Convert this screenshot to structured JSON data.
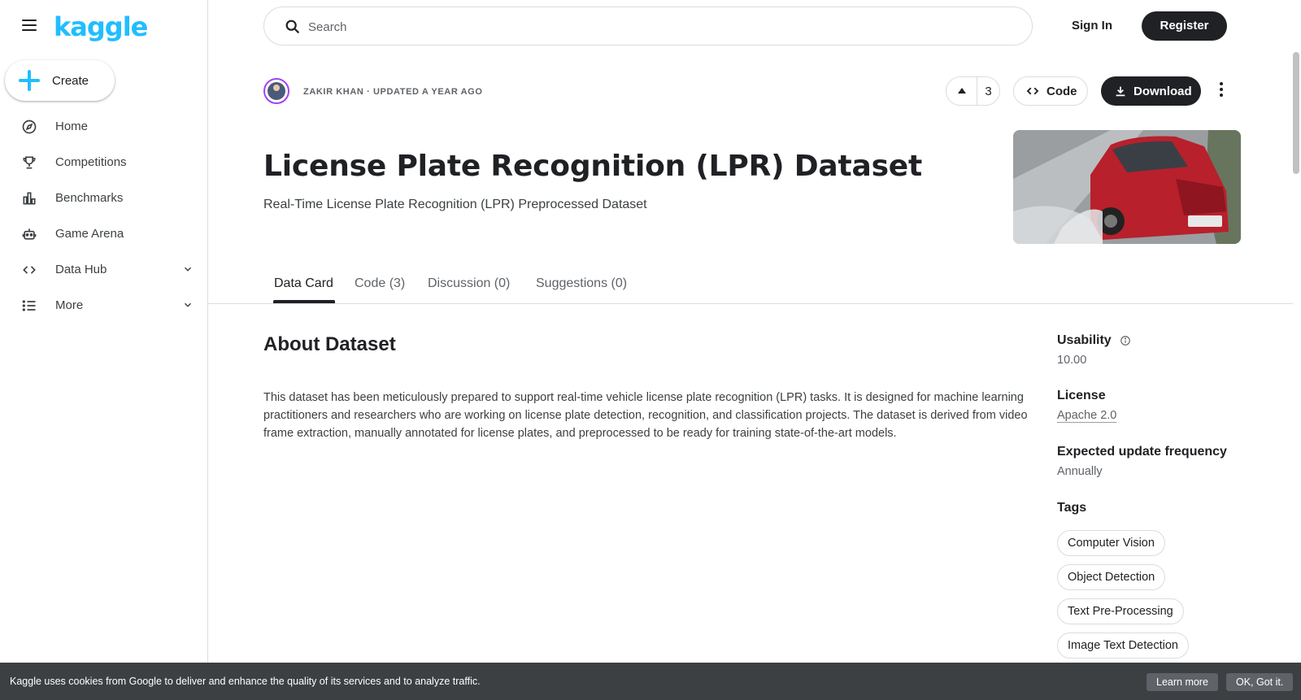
{
  "sidebar": {
    "logo": "kaggle",
    "create_label": "Create",
    "items": [
      {
        "label": "Home"
      },
      {
        "label": "Competitions"
      },
      {
        "label": "Benchmarks"
      },
      {
        "label": "Game Arena"
      },
      {
        "label": "Data Hub"
      },
      {
        "label": "More"
      }
    ]
  },
  "header": {
    "search_placeholder": "Search",
    "sign_in": "Sign In",
    "register": "Register"
  },
  "dataset": {
    "author_line": "ZAKIR KHAN · UPDATED A YEAR AGO",
    "vote_count": "3",
    "code_label": "Code",
    "download_label": "Download",
    "title": "License Plate Recognition (LPR) Dataset",
    "subtitle": "Real-Time License Plate Recognition (LPR) Preprocessed Dataset"
  },
  "tabs": [
    {
      "label": "Data Card"
    },
    {
      "label": "Code (3)"
    },
    {
      "label": "Discussion (0)"
    },
    {
      "label": "Suggestions (0)"
    }
  ],
  "content": {
    "about_heading": "About Dataset",
    "description": "This dataset has been meticulously prepared to support real-time vehicle license plate recognition (LPR) tasks. It is designed for machine learning practitioners and researchers who are working on license plate detection, recognition, and classification projects. The dataset is derived from video frame extraction, manually annotated for license plates, and preprocessed to be ready for training state-of-the-art models."
  },
  "meta": {
    "usability_label": "Usability",
    "usability_value": "10.00",
    "license_label": "License",
    "license_value": "Apache 2.0",
    "frequency_label": "Expected update frequency",
    "frequency_value": "Annually",
    "tags_label": "Tags",
    "tags": [
      "Computer Vision",
      "Object Detection",
      "Text Pre-Processing",
      "Image Text Detection"
    ]
  },
  "cookie": {
    "message": "Kaggle uses cookies from Google to deliver and enhance the quality of its services and to analyze traffic.",
    "learn_more": "Learn more",
    "ok": "OK, Got it."
  },
  "colors": {
    "brand": "#20beff",
    "text": "#202124",
    "muted": "#5f6368",
    "border": "#dadce0",
    "avatar_ring": "#a142f4",
    "cookie_bg": "#3c4043"
  }
}
